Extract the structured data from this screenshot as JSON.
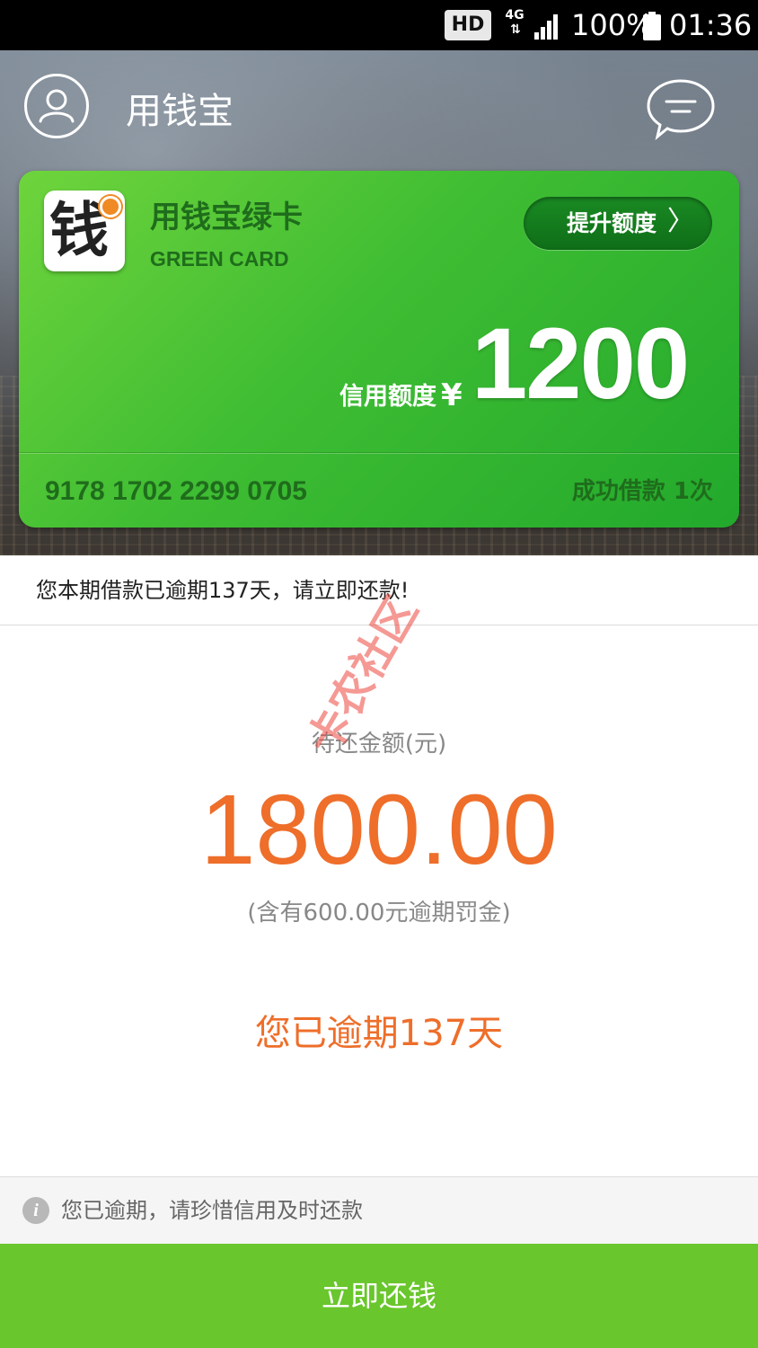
{
  "status_bar": {
    "hd_badge": "HD",
    "network": "4G",
    "network_arrows": "⇅",
    "battery_percent": "100%",
    "time": "01:36"
  },
  "header": {
    "title": "用钱宝",
    "avatar_icon": "user-icon",
    "message_icon": "message-icon"
  },
  "card": {
    "logo_glyph": "钱",
    "name": "用钱宝绿卡",
    "subtitle": "GREEN CARD",
    "upgrade_label": "提升额度",
    "limit_label": "信用额度",
    "currency": "¥",
    "limit_value": "1200",
    "card_number": "9178 1702 2299 0705",
    "loan_count": "成功借款 1次"
  },
  "notice": {
    "text": "您本期借款已逾期137天，请立即还款!"
  },
  "amount": {
    "label": "待还金额(元)",
    "value": "1800.00",
    "penalty_note": "(含有600.00元逾期罚金)",
    "overdue_days": "您已逾期137天"
  },
  "tip": {
    "icon": "info-icon",
    "text": "您已逾期，请珍惜信用及时还款"
  },
  "repay_button": {
    "label": "立即还钱"
  },
  "watermark": {
    "text": "卡农社区"
  },
  "colors": {
    "card_green": "#3fbd33",
    "accent_orange": "#ee6e2a",
    "button_green": "#69c62c"
  }
}
